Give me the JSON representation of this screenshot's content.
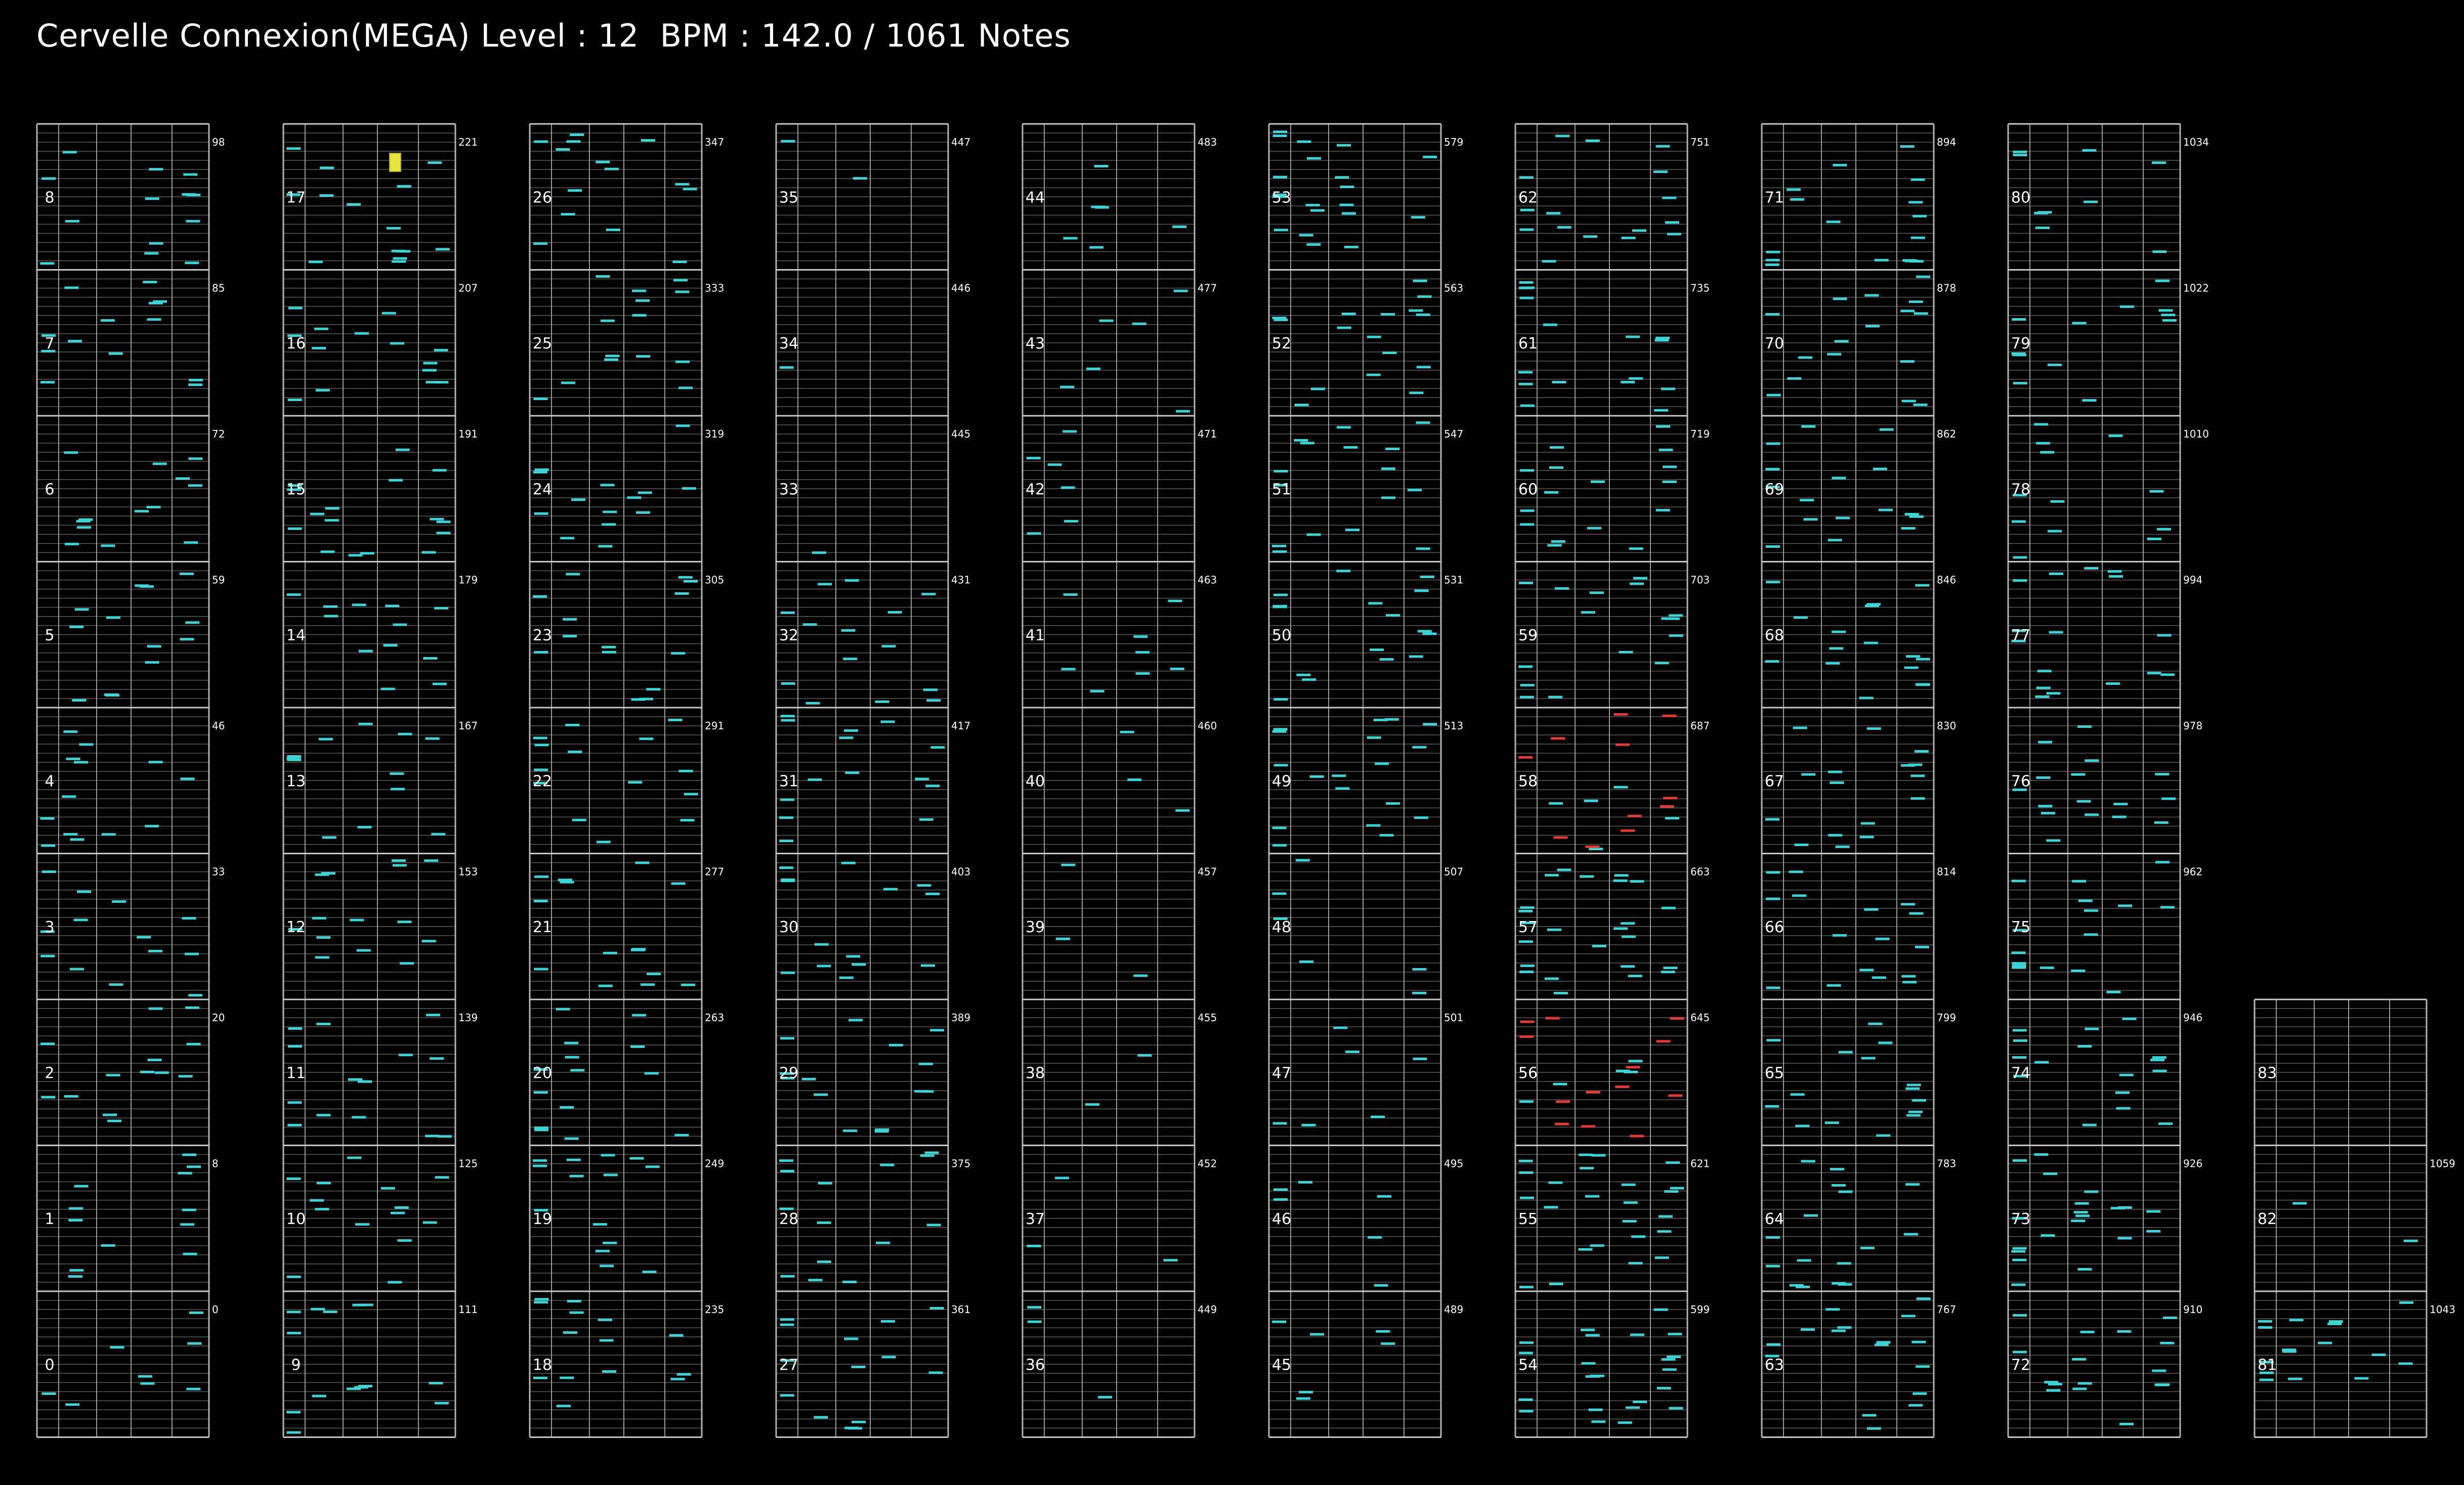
{
  "header": {
    "title": "Cervelle Connexion(MEGA) Level : 12  BPM : 142.0 / 1061 Notes"
  },
  "song": {
    "name": "Cervelle Connexion",
    "difficulty": "MEGA",
    "level": 12,
    "bpm": 142.0,
    "total_notes": 1061
  },
  "colors": {
    "background": "#000000",
    "measure_line": "#c8c8c8",
    "beat_line": "#5a5a5a",
    "lane_line": "#b4b4b4",
    "note_cyan": "#3fd3d8",
    "note_red": "#e03c32",
    "note_yellow": "#e8e43c"
  },
  "chart_data": {
    "type": "note-chart",
    "measures": [
      0,
      1,
      2,
      3,
      4,
      5,
      6,
      7,
      8,
      9,
      10,
      11,
      12,
      13,
      14,
      15,
      16,
      17,
      18,
      19,
      20,
      21,
      22,
      23,
      24,
      25,
      26,
      27,
      28,
      29,
      30,
      31,
      32,
      33,
      34,
      35,
      36,
      37,
      38,
      39,
      40,
      41,
      42,
      43,
      44,
      45,
      46,
      47,
      48,
      49,
      50,
      51,
      52,
      53,
      54,
      55,
      56,
      57,
      58,
      59,
      60,
      61,
      62,
      63,
      64,
      65,
      66,
      67,
      68,
      69,
      70,
      71,
      72,
      73,
      74,
      75,
      76,
      77,
      78,
      79,
      80,
      81,
      82,
      83
    ],
    "cumulative_note_counts": [
      0,
      8,
      20,
      33,
      46,
      59,
      72,
      85,
      98,
      111,
      125,
      139,
      153,
      167,
      179,
      191,
      207,
      221,
      235,
      249,
      263,
      277,
      291,
      305,
      319,
      333,
      347,
      361,
      375,
      389,
      403,
      417,
      431,
      445,
      446,
      447,
      449,
      452,
      455,
      457,
      460,
      463,
      471,
      477,
      483,
      489,
      495,
      501,
      507,
      513,
      531,
      547,
      563,
      579,
      599,
      621,
      645,
      663,
      687,
      703,
      719,
      735,
      751,
      767,
      783,
      799,
      814,
      830,
      846,
      862,
      878,
      894,
      910,
      926,
      946,
      962,
      978,
      994,
      1010,
      1022,
      1034,
      1043,
      1059
    ],
    "measures_per_column": 9,
    "red_note_measures": [
      56,
      58
    ],
    "highlight_measure": 17
  }
}
